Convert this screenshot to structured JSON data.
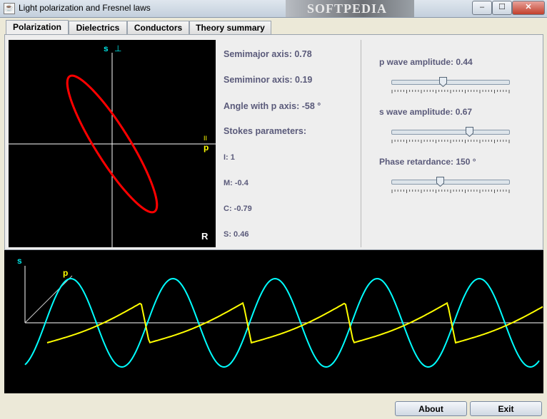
{
  "window": {
    "title": "Light polarization and Fresnel laws",
    "watermark": "SOFTPEDIA",
    "minimize": "–",
    "maximize": "☐",
    "close": "✕"
  },
  "tabs": [
    {
      "label": "Polarization",
      "active": true
    },
    {
      "label": "Dielectrics",
      "active": false
    },
    {
      "label": "Conductors",
      "active": false
    },
    {
      "label": "Theory summary",
      "active": false
    }
  ],
  "polar_plot": {
    "s_label": "s",
    "perp_symbol": "⊥",
    "p_label": "p",
    "parallel_symbol": "II",
    "handedness": "R"
  },
  "info": {
    "semimajor": "Semimajor axis: 0.78",
    "semiminor": "Semiminor axis: 0.19",
    "angle": "Angle with p axis: -58 °",
    "stokes_title": "Stokes parameters:",
    "I": "I: 1",
    "M": "M: -0.4",
    "C": "C: -0.79",
    "S": "S: 0.46"
  },
  "controls": {
    "p_amp": {
      "label": "p wave amplitude: 0.44",
      "value": 0.44
    },
    "s_amp": {
      "label": "s wave amplitude: 0.67",
      "value": 0.67
    },
    "phase": {
      "label": "Phase retardance: 150 °",
      "value": 150,
      "max": 360
    }
  },
  "wave_plot": {
    "s_label": "s",
    "p_label": "p"
  },
  "buttons": {
    "about": "About",
    "exit": "Exit"
  },
  "colors": {
    "ellipse": "#ff0000",
    "p_wave": "#ffff00",
    "s_wave": "#00ffff",
    "axis": "#ffffff"
  }
}
